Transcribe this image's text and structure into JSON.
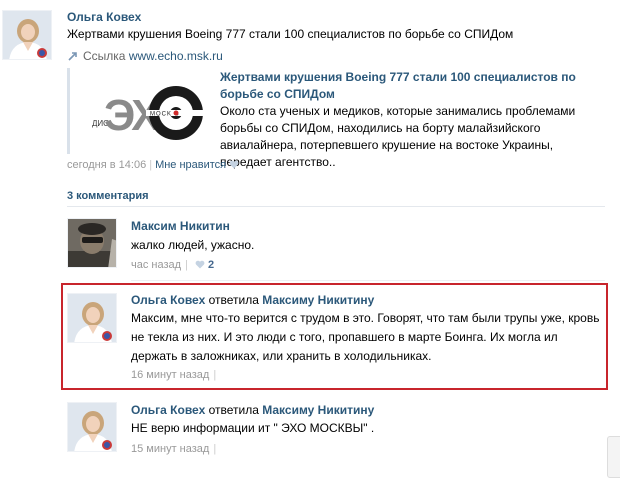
{
  "post": {
    "author": "Ольга Ковех",
    "text": "Жертвами крушения Boeing 777 стали 100 специалистов по борьбе со СПИДом",
    "source_label": "Ссылка",
    "source_url": "www.echo.msk.ru",
    "attachment": {
      "title": "Жертвами крушения Boeing 777 стали 100 специалистов по борьбе со СПИДом",
      "description": "Около ста ученых и медиков, которые занимались проблемами борьбы со СПИДом, находились на борту малайзийского авиалайнера, потерпевшего крушение на востоке Украины, передает агентство..",
      "logo_text_left": "ЭХО",
      "logo_text_small": "москвы"
    },
    "time": "сегодня в 14:06",
    "like_label": "Мне нравится"
  },
  "comments_count": "3 комментария",
  "comments": [
    {
      "author": "Максим Никитин",
      "text": "жалко людей, ужасно.",
      "time": "час назад",
      "likes": "2"
    },
    {
      "author": "Ольга Ковех",
      "replied_word": "ответила",
      "reply_to": "Максиму Никитину",
      "text": "Максим, мне что-то верится с трудом в это. Говорят, что там были трупы уже, кровь не текла из них. И это люди с того, пропавшего в марте Боинга. Их могла ил держать в заложниках, или хранить в холодильниках.",
      "time": "16 минут назад"
    },
    {
      "author": "Ольга Ковех",
      "replied_word": "ответила",
      "reply_to": "Максиму Никитину",
      "text": "НЕ верю информации ит \" ЭХО МОСКВЫ\" .",
      "time": "15 минут назад"
    }
  ],
  "colors": {
    "link": "#2b587a",
    "highlight": "#c8252c",
    "meta": "#999999"
  }
}
